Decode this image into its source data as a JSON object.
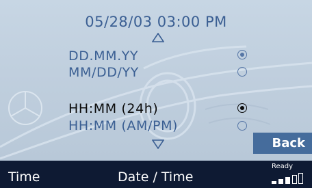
{
  "header": {
    "current_datetime": "05/28/03 03:00 PM"
  },
  "date_formats": [
    {
      "label": "DD.MM.YY",
      "selected": true
    },
    {
      "label": "MM/DD/YY",
      "selected": false
    }
  ],
  "time_formats": [
    {
      "label": "HH:MM (24h)",
      "selected": true
    },
    {
      "label": "HH:MM (AM/PM)",
      "selected": false
    }
  ],
  "back_button": {
    "label": "Back"
  },
  "bottom_bar": {
    "left_label": "Time",
    "center_label": "Date / Time",
    "status_label": "Ready"
  },
  "icons": {
    "scroll_up": "triangle-up-icon",
    "scroll_down": "triangle-down-icon",
    "signal": "signal-strength-icon",
    "background": "car-front-artwork"
  },
  "colors": {
    "screen_bg": "#c0cfde",
    "text_blue": "#3b5f93",
    "text_active": "#0b0b0b",
    "button_bg": "#456c9c",
    "bottom_bar_bg": "#0e1a33"
  }
}
